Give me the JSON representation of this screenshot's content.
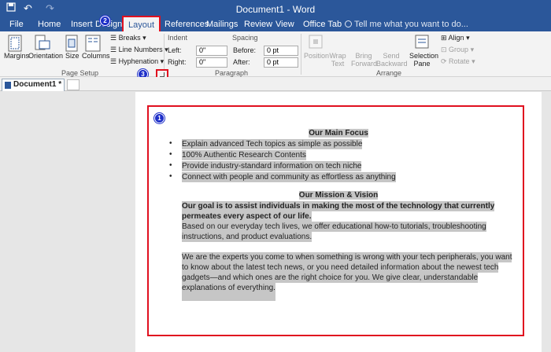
{
  "titlebar": {
    "title": "Document1 - Word",
    "undo_glyph": "↶",
    "redo_glyph": "↷"
  },
  "tabs": [
    "File",
    "Home",
    "Insert",
    "Design",
    "Layout",
    "References",
    "Mailings",
    "Review",
    "View",
    "Office Tab"
  ],
  "tellme": "Tell me what you want to do...",
  "ribbon": {
    "margins": "Margins",
    "orientation": "Orientation",
    "size": "Size",
    "columns": "Columns",
    "breaks": "Breaks",
    "line_numbers": "Line Numbers",
    "hyphenation": "Hyphenation",
    "page_setup": "Page Setup",
    "indent": "Indent",
    "left": "Left:",
    "right": "Right:",
    "left_val": "0\"",
    "right_val": "0\"",
    "spacing": "Spacing",
    "before": "Before:",
    "after": "After:",
    "before_val": "0 pt",
    "after_val": "0 pt",
    "paragraph": "Paragraph",
    "position": "Position",
    "wrap_text": "Wrap Text",
    "bring_forward": "Bring Forward",
    "send_backward": "Send Backward",
    "selection_pane": "Selection Pane",
    "align": "Align",
    "group": "Group",
    "rotate": "Rotate",
    "arrange": "Arrange"
  },
  "doctab": "Document1 *",
  "markers": [
    "1",
    "2",
    "3"
  ],
  "doc": {
    "heading1": "Our Main Focus",
    "bullets": [
      "Explain advanced Tech topics as simple as possible",
      "100% Authentic Research Contents",
      "Provide industry-standard information on tech niche",
      "Connect with people and community as effortless as anything"
    ],
    "heading2": "Our Mission & Vision",
    "bold1": "Our goal is to assist individuals in making the most of the technology that currently",
    "bold2": "permeates every aspect of our life.",
    "p1a": "Based on our everyday tech lives, we offer educational how-to tutorials, troubleshooting",
    "p1b": "instructions, and product evaluations.",
    "p2a": "We are the experts you come to when something is wrong with your tech peripherals, you want",
    "p2b": "to know about the latest tech news, or you need detailed information about the newest tech",
    "p2c": "gadgets—and which ones are the right choice for you. We give clear, understandable",
    "p2d": "explanations of everything."
  }
}
